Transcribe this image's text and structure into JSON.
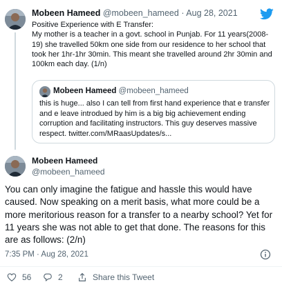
{
  "tweet1": {
    "name": "Mobeen Hameed",
    "handle": "@mobeen_hameed",
    "separator": "·",
    "date": "Aug 28, 2021",
    "lines": [
      "Positive Experience with E Transfer:",
      "My mother is a teacher in a govt. school in Punjab. For 11 years(2008-19) she travelled 50km one side from our residence to her school that took her 1hr-1hr 30min. This meant she travelled around 2hr 30min and 100km each day. (1/n)"
    ],
    "quote": {
      "name": "Mobeen Hameed",
      "handle": "@mobeen_hameed",
      "text": "this is huge... also I can tell from first hand experience that e transfer and e leave introdued by him is a big big achievement ending corruption and facilitating instructors. This guy deserves massive respect. twitter.com/MRaasUpdates/s..."
    }
  },
  "tweet2": {
    "name": "Mobeen Hameed",
    "handle": "@mobeen_hameed",
    "text": "You can only imagine the fatigue and hassle this would have caused. Now speaking on a merit basis, what more could be a more meritorious reason for a transfer to a nearby school? Yet for 11 years she was not able to get that done. The reasons for this are as follows: (2/n)",
    "timestamp": "7:35 PM · Aug 28, 2021",
    "likes": "56",
    "replies": "2",
    "share_label": "Share this Tweet"
  },
  "colors": {
    "twitter_blue": "#1d9bf0",
    "text_primary": "#0f1419",
    "text_secondary": "#536471",
    "border": "#cfd9de"
  },
  "icons": {
    "brand": "twitter-bird-icon",
    "info": "info-icon",
    "like": "heart-icon",
    "reply": "reply-icon",
    "share": "share-icon"
  }
}
